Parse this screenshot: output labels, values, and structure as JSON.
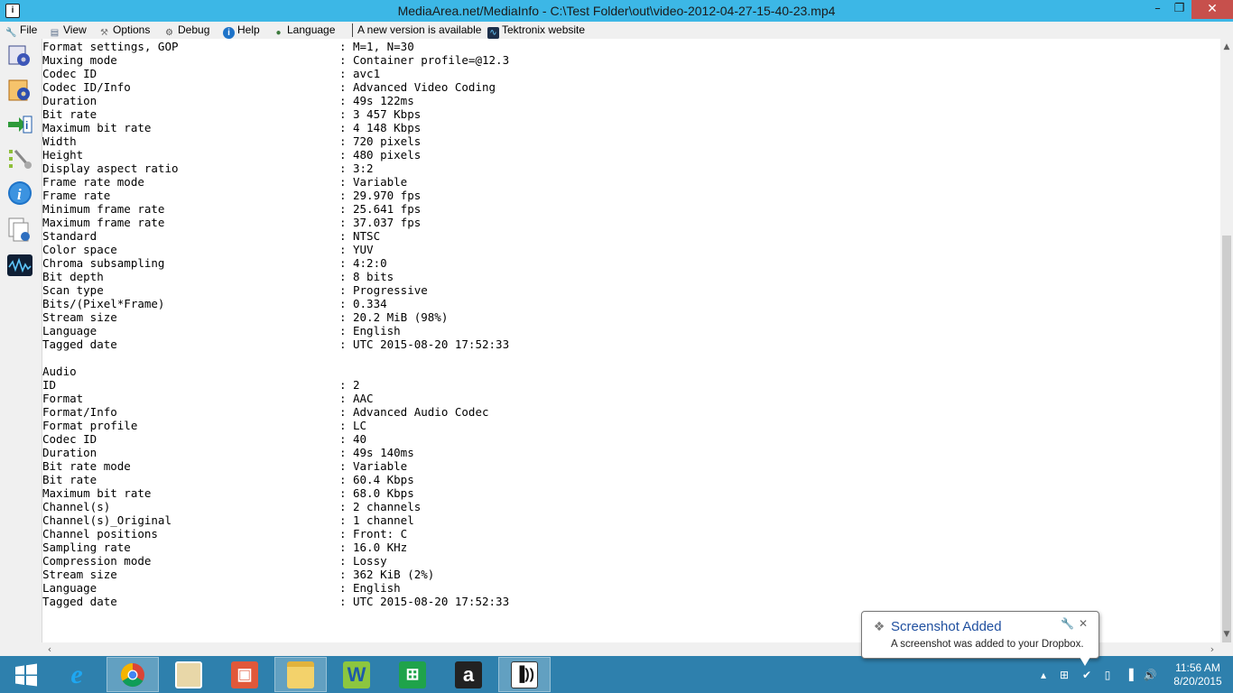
{
  "window": {
    "title": "MediaArea.net/MediaInfo - C:\\Test Folder\\out\\video-2012-04-27-15-40-23.mp4",
    "minimize": "–",
    "maximize": "❐",
    "close": "✕"
  },
  "menubar": {
    "file": "File",
    "view": "View",
    "options": "Options",
    "debug": "Debug",
    "help": "Help",
    "language": "Language",
    "new_version": "A new version is available",
    "tektronix": "Tektronix website"
  },
  "video_lines": [
    {
      "k": "Format settings, GOP",
      "v": "M=1, N=30"
    },
    {
      "k": "Muxing mode",
      "v": "Container profile=@12.3"
    },
    {
      "k": "Codec ID",
      "v": "avc1"
    },
    {
      "k": "Codec ID/Info",
      "v": "Advanced Video Coding"
    },
    {
      "k": "Duration",
      "v": "49s 122ms"
    },
    {
      "k": "Bit rate",
      "v": "3 457 Kbps"
    },
    {
      "k": "Maximum bit rate",
      "v": "4 148 Kbps"
    },
    {
      "k": "Width",
      "v": "720 pixels"
    },
    {
      "k": "Height",
      "v": "480 pixels"
    },
    {
      "k": "Display aspect ratio",
      "v": "3:2"
    },
    {
      "k": "Frame rate mode",
      "v": "Variable"
    },
    {
      "k": "Frame rate",
      "v": "29.970 fps"
    },
    {
      "k": "Minimum frame rate",
      "v": "25.641 fps"
    },
    {
      "k": "Maximum frame rate",
      "v": "37.037 fps"
    },
    {
      "k": "Standard",
      "v": "NTSC"
    },
    {
      "k": "Color space",
      "v": "YUV"
    },
    {
      "k": "Chroma subsampling",
      "v": "4:2:0"
    },
    {
      "k": "Bit depth",
      "v": "8 bits"
    },
    {
      "k": "Scan type",
      "v": "Progressive"
    },
    {
      "k": "Bits/(Pixel*Frame)",
      "v": "0.334"
    },
    {
      "k": "Stream size",
      "v": "20.2 MiB (98%)"
    },
    {
      "k": "Language",
      "v": "English"
    },
    {
      "k": "Tagged date",
      "v": "UTC 2015-08-20 17:52:33"
    }
  ],
  "audio_header": "Audio",
  "audio_lines": [
    {
      "k": "ID",
      "v": "2"
    },
    {
      "k": "Format",
      "v": "AAC"
    },
    {
      "k": "Format/Info",
      "v": "Advanced Audio Codec"
    },
    {
      "k": "Format profile",
      "v": "LC"
    },
    {
      "k": "Codec ID",
      "v": "40"
    },
    {
      "k": "Duration",
      "v": "49s 140ms"
    },
    {
      "k": "Bit rate mode",
      "v": "Variable"
    },
    {
      "k": "Bit rate",
      "v": "60.4 Kbps"
    },
    {
      "k": "Maximum bit rate",
      "v": "68.0 Kbps"
    },
    {
      "k": "Channel(s)",
      "v": "2 channels"
    },
    {
      "k": "Channel(s)_Original",
      "v": "1 channel"
    },
    {
      "k": "Channel positions",
      "v": "Front: C"
    },
    {
      "k": "Sampling rate",
      "v": "16.0 KHz"
    },
    {
      "k": "Compression mode",
      "v": "Lossy"
    },
    {
      "k": "Stream size",
      "v": "362 KiB (2%)"
    },
    {
      "k": "Language",
      "v": "English"
    },
    {
      "k": "Tagged date",
      "v": "UTC 2015-08-20 17:52:33"
    }
  ],
  "separator": ":",
  "toast": {
    "title": "Screenshot Added",
    "message": "A screenshot was added to your Dropbox."
  },
  "clock": {
    "time": "11:56 AM",
    "date": "8/20/2015"
  },
  "icons": {
    "app": "mediainfo-icon",
    "taskbar": [
      "windows-start-icon",
      "internet-explorer-icon",
      "chrome-icon",
      "photos-icon",
      "office-icon",
      "file-explorer-icon",
      "w-app-icon",
      "store-icon",
      "amazon-icon",
      "mediainfo-icon"
    ]
  },
  "colors": {
    "titlebar": "#3cb7e6",
    "close_button": "#c7504c",
    "taskbar": "#2e80ad",
    "toast_title": "#1f4f9f"
  }
}
